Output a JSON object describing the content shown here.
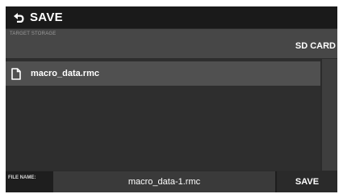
{
  "header": {
    "back_icon": "return-arrow-icon",
    "title": "SAVE"
  },
  "storage": {
    "label": "TARGET STORAGE",
    "value": "SD CARD"
  },
  "file_list": {
    "items": [
      {
        "icon": "document-icon",
        "name": "macro_data.rmc",
        "selected": true
      }
    ]
  },
  "footer": {
    "file_name_label": "FILE NAME:",
    "file_name_value": "macro_data-1.rmc",
    "save_label": "SAVE"
  },
  "colors": {
    "title_bar": "#1a1a1a",
    "storage_bar": "#474747",
    "list_background": "#2e2e2e",
    "selected_item": "#505050",
    "text": "#ffffff"
  }
}
